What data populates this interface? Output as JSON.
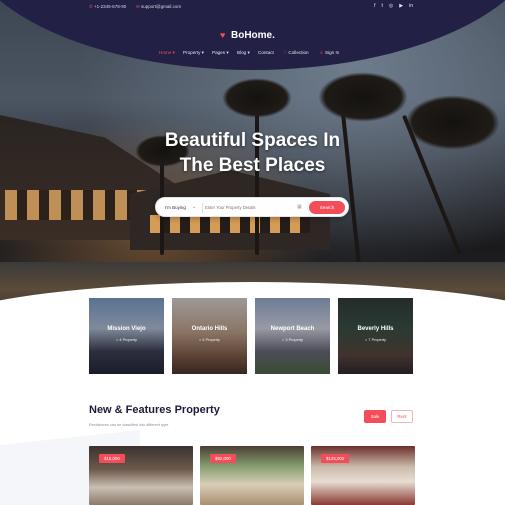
{
  "topbar": {
    "phone": "+1-2345-678-90",
    "email": "support@gmail.com",
    "social_icons": [
      "facebook-icon",
      "twitter-icon",
      "instagram-icon",
      "youtube-icon",
      "linkedin-icon"
    ]
  },
  "brand": {
    "logo_text": "BoHome.",
    "accent": "#f24d58",
    "nav_bg": "#232046"
  },
  "nav": {
    "home": "Home",
    "property": "Property",
    "pages": "Pages",
    "blog": "Blog",
    "contact": "Contact",
    "collection": "Collection",
    "signin": "Sign In"
  },
  "hero": {
    "title_line1": "Beautiful Spaces In",
    "title_line2": "The Best Places"
  },
  "search": {
    "mode": "I'm Buying",
    "placeholder": "Enter Your Property Details",
    "button": "Search"
  },
  "cities": [
    {
      "name": "Mission Viejo",
      "count": "4 Property"
    },
    {
      "name": "Ontario Hills",
      "count": "6 Property"
    },
    {
      "name": "Newport Beach",
      "count": "3 Property"
    },
    {
      "name": "Beverly Hills",
      "count": "7 Property"
    }
  ],
  "featured": {
    "title": "New & Features Property",
    "subtitle": "Residences can be classified into different type.",
    "sale": "Sale",
    "rent": "Rent"
  },
  "properties": [
    {
      "price": "$15,000"
    },
    {
      "price": "$92,000"
    },
    {
      "price": "$125,000"
    }
  ]
}
